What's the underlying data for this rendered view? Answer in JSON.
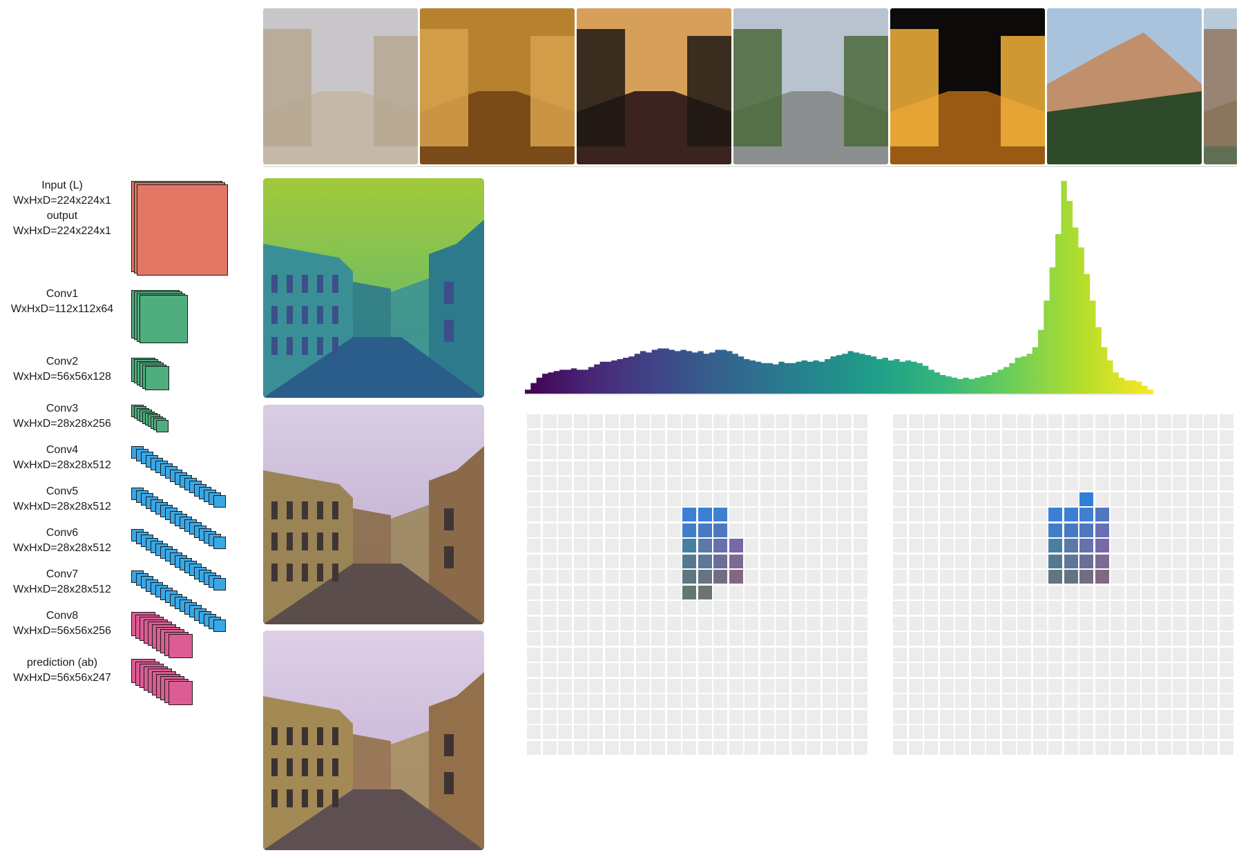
{
  "thumbnails": [
    {
      "name": "thumb-street-faded",
      "sky": "#c9c6c9",
      "ground": "#c4b9a8",
      "accent": "#b7a792"
    },
    {
      "name": "thumb-autumn-forest",
      "sky": "#b7822f",
      "ground": "#7a4a18",
      "accent": "#d7a24c"
    },
    {
      "name": "thumb-sunset-street",
      "sky": "#d7a05a",
      "ground": "#3b2420",
      "accent": "#1f1814"
    },
    {
      "name": "thumb-boulevard",
      "sky": "#b8c3cf",
      "ground": "#8b8f8f",
      "accent": "#4b6a3b"
    },
    {
      "name": "thumb-night-building",
      "sky": "#0d0a0a",
      "ground": "#9b5a14",
      "accent": "#f2b13a"
    },
    {
      "name": "thumb-mountain",
      "sky": "#a9c3dd",
      "ground": "#2f4a2a",
      "accent": "#c08f6c"
    },
    {
      "name": "thumb-partial",
      "sky": "#b9cbd9",
      "ground": "#5e6f53",
      "accent": "#91785f"
    }
  ],
  "layers": [
    {
      "name": "input",
      "lines": [
        "Input (L)",
        "WxHxD=224x224x1",
        "output",
        "WxHxD=224x224x1"
      ],
      "color": "#e27766",
      "depth": 3
    },
    {
      "name": "conv1",
      "lines": [
        "Conv1",
        "WxHxD=112x112x64"
      ],
      "color": "#4fad7e",
      "depth": 4
    },
    {
      "name": "conv2",
      "lines": [
        "Conv2",
        "WxHxD=56x56x128"
      ],
      "color": "#4fad7e",
      "depth": 6
    },
    {
      "name": "conv3",
      "lines": [
        "Conv3",
        "WxHxD=28x28x256"
      ],
      "color": "#4fad7e",
      "depth": 10
    },
    {
      "name": "conv4",
      "lines": [
        "Conv4",
        "WxHxD=28x28x512"
      ],
      "color": "#39a7e6",
      "depth": 18
    },
    {
      "name": "conv5",
      "lines": [
        "Conv5",
        "WxHxD=28x28x512"
      ],
      "color": "#39a7e6",
      "depth": 18
    },
    {
      "name": "conv6",
      "lines": [
        "Conv6",
        "WxHxD=28x28x512"
      ],
      "color": "#39a7e6",
      "depth": 18
    },
    {
      "name": "conv7",
      "lines": [
        "Conv7",
        "WxHxD=28x28x512"
      ],
      "color": "#39a7e6",
      "depth": 18
    },
    {
      "name": "conv8",
      "lines": [
        "Conv8",
        "WxHxD=56x56x256"
      ],
      "color": "#dc5c94",
      "depth": 10
    },
    {
      "name": "prediction",
      "lines": [
        "prediction (ab)",
        "WxHxD=56x56x247"
      ],
      "color": "#dc5c94",
      "depth": 10
    }
  ],
  "panels": [
    {
      "name": "luminance-panel",
      "style": "viridis"
    },
    {
      "name": "prediction-panel",
      "style": "color"
    },
    {
      "name": "ground-truth-panel",
      "style": "color-alt"
    }
  ],
  "histogram": {
    "values": [
      3,
      8,
      12,
      15,
      16,
      17,
      18,
      18,
      19,
      18,
      18,
      20,
      22,
      24,
      24,
      25,
      26,
      27,
      28,
      30,
      32,
      31,
      33,
      34,
      34,
      33,
      32,
      33,
      32,
      31,
      32,
      30,
      31,
      33,
      33,
      32,
      30,
      28,
      26,
      25,
      24,
      23,
      23,
      22,
      24,
      23,
      23,
      24,
      25,
      24,
      25,
      24,
      26,
      28,
      29,
      30,
      32,
      31,
      30,
      29,
      28,
      26,
      27,
      25,
      26,
      24,
      25,
      24,
      23,
      21,
      18,
      16,
      14,
      13,
      12,
      11,
      12,
      11,
      12,
      13,
      14,
      16,
      18,
      20,
      23,
      27,
      28,
      30,
      35,
      48,
      70,
      95,
      120,
      160,
      145,
      125,
      110,
      90,
      70,
      50,
      35,
      25,
      16,
      12,
      10,
      10,
      9,
      6,
      3
    ],
    "colorStops": [
      "#440154",
      "#482878",
      "#3e4989",
      "#31688e",
      "#26828e",
      "#1f9e89",
      "#35b779",
      "#6ece58",
      "#b5de2b",
      "#fde725"
    ]
  },
  "grids": [
    {
      "name": "grid-prediction",
      "rows": 22,
      "cols": 22,
      "empty": "#ececec",
      "filled": [
        {
          "r": 6,
          "c": 10,
          "color": "#3b7fd8"
        },
        {
          "r": 6,
          "c": 11,
          "color": "#3b7fd8"
        },
        {
          "r": 6,
          "c": 12,
          "color": "#3f80d0"
        },
        {
          "r": 7,
          "c": 10,
          "color": "#3f7fc8"
        },
        {
          "r": 7,
          "c": 11,
          "color": "#4779c4"
        },
        {
          "r": 7,
          "c": 12,
          "color": "#4d78bf"
        },
        {
          "r": 8,
          "c": 10,
          "color": "#4a7fa4"
        },
        {
          "r": 8,
          "c": 11,
          "color": "#5a79a8"
        },
        {
          "r": 8,
          "c": 12,
          "color": "#6772ad"
        },
        {
          "r": 8,
          "c": 13,
          "color": "#7868a8"
        },
        {
          "r": 9,
          "c": 10,
          "color": "#557a90"
        },
        {
          "r": 9,
          "c": 11,
          "color": "#5e7797"
        },
        {
          "r": 9,
          "c": 12,
          "color": "#6a6f98"
        },
        {
          "r": 9,
          "c": 13,
          "color": "#7b6a92"
        },
        {
          "r": 10,
          "c": 10,
          "color": "#5e7780"
        },
        {
          "r": 10,
          "c": 11,
          "color": "#657382"
        },
        {
          "r": 10,
          "c": 12,
          "color": "#716e84"
        },
        {
          "r": 10,
          "c": 13,
          "color": "#82677f"
        },
        {
          "r": 11,
          "c": 10,
          "color": "#637873"
        },
        {
          "r": 11,
          "c": 11,
          "color": "#6c7472"
        }
      ]
    },
    {
      "name": "grid-ground-truth",
      "rows": 22,
      "cols": 22,
      "empty": "#ececec",
      "filled": [
        {
          "r": 5,
          "c": 12,
          "color": "#2f7fd6"
        },
        {
          "r": 6,
          "c": 10,
          "color": "#3b7fd8"
        },
        {
          "r": 6,
          "c": 11,
          "color": "#3b7fd8"
        },
        {
          "r": 6,
          "c": 12,
          "color": "#3f80d0"
        },
        {
          "r": 6,
          "c": 13,
          "color": "#5077c2"
        },
        {
          "r": 7,
          "c": 10,
          "color": "#3f7fc8"
        },
        {
          "r": 7,
          "c": 11,
          "color": "#4779c4"
        },
        {
          "r": 7,
          "c": 12,
          "color": "#4d78bf"
        },
        {
          "r": 7,
          "c": 13,
          "color": "#6a6fb3"
        },
        {
          "r": 8,
          "c": 10,
          "color": "#4a7fa4"
        },
        {
          "r": 8,
          "c": 11,
          "color": "#5a79a8"
        },
        {
          "r": 8,
          "c": 12,
          "color": "#6772ad"
        },
        {
          "r": 8,
          "c": 13,
          "color": "#7868a8"
        },
        {
          "r": 9,
          "c": 10,
          "color": "#557a90"
        },
        {
          "r": 9,
          "c": 11,
          "color": "#5e7797"
        },
        {
          "r": 9,
          "c": 12,
          "color": "#6a6f98"
        },
        {
          "r": 9,
          "c": 13,
          "color": "#7b6a92"
        },
        {
          "r": 10,
          "c": 10,
          "color": "#5e7780"
        },
        {
          "r": 10,
          "c": 11,
          "color": "#657382"
        },
        {
          "r": 10,
          "c": 12,
          "color": "#716e84"
        },
        {
          "r": 10,
          "c": 13,
          "color": "#82677f"
        }
      ]
    }
  ]
}
